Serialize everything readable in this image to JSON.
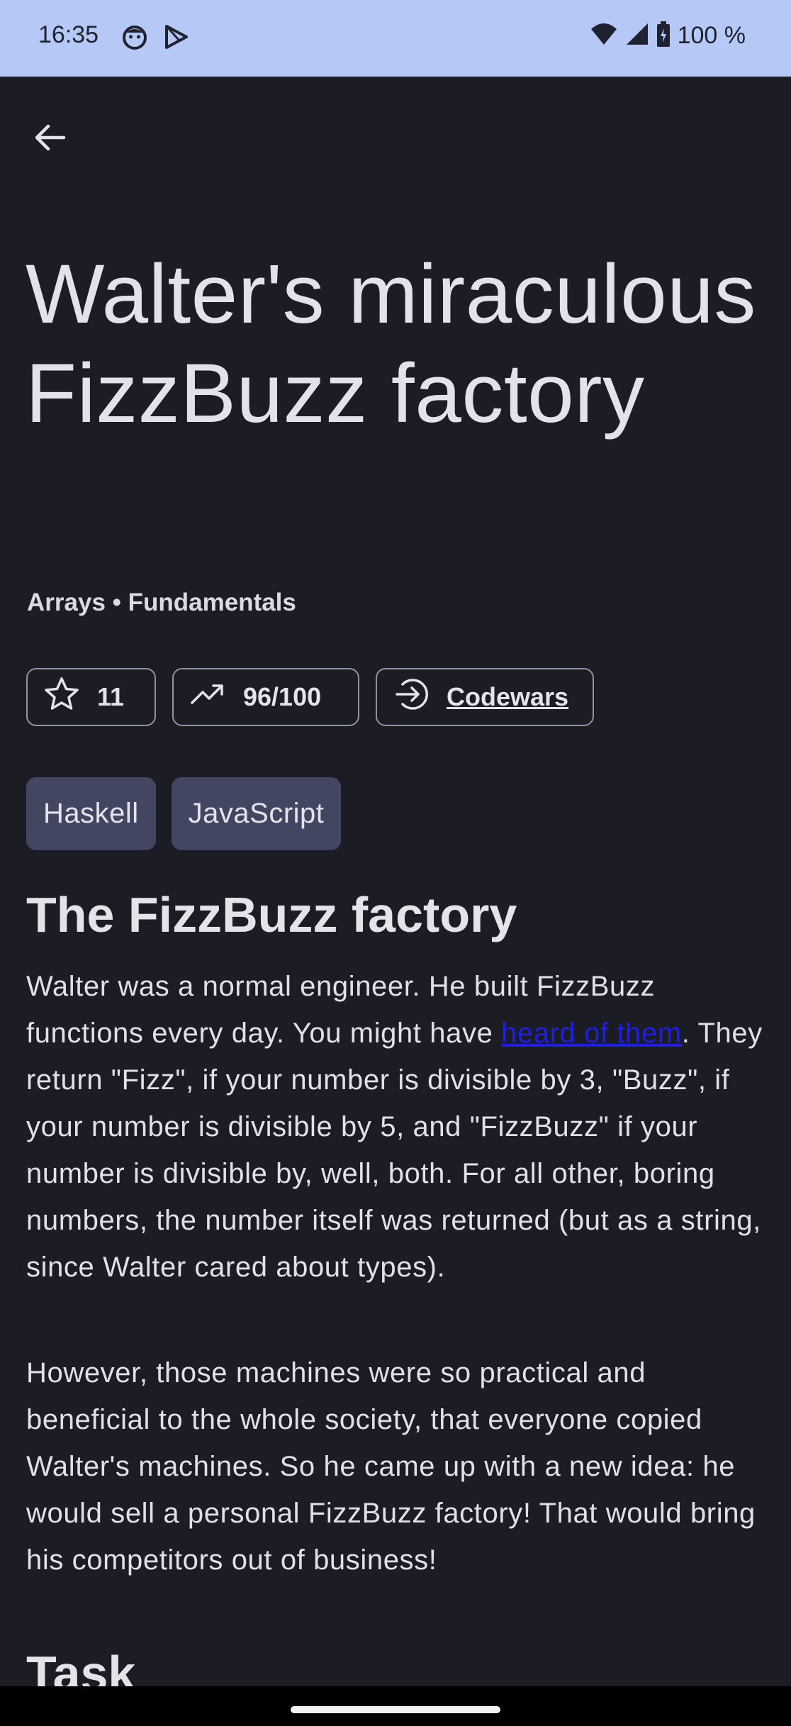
{
  "status_bar": {
    "time": "16:35",
    "battery": "100 %",
    "icons": [
      "face-icon",
      "play-icon",
      "wifi-icon",
      "signal-icon",
      "battery-icon"
    ]
  },
  "header": {
    "back_icon": "arrow-left-icon"
  },
  "kata": {
    "title": "Walter's miraculous FizzBuzz factory",
    "categories": "Arrays • Fundamentals",
    "stars": "11",
    "rank": "96/100",
    "source": "Codewars",
    "languages": [
      "Haskell",
      "JavaScript"
    ]
  },
  "description": {
    "heading": "The FizzBuzz factory",
    "p1_a": "Walter was a normal engineer. He built FizzBuzz functions every day. You might have ",
    "p1_link": "heard of them",
    "p1_b": ". They return \"Fizz\", if your number is divisible by 3, \"Buzz\", if your number is divisible by 5, and \"FizzBuzz\" if your number is divisible by, well, both. For all other, boring numbers, the number itself was returned (but as a string, since Walter cared about types).",
    "p2": "However, those machines were so practical and beneficial to the whole society, that everyone copied Walter's machines. So he came up with a new idea: he would sell a personal FizzBuzz factory! That would bring his competitors out of business!",
    "task_heading": "Task"
  },
  "colors": {
    "background": "#1b1c24",
    "status_bar": "#b6c8f5",
    "tag_background": "#434661",
    "link": "#1d1ee6"
  }
}
